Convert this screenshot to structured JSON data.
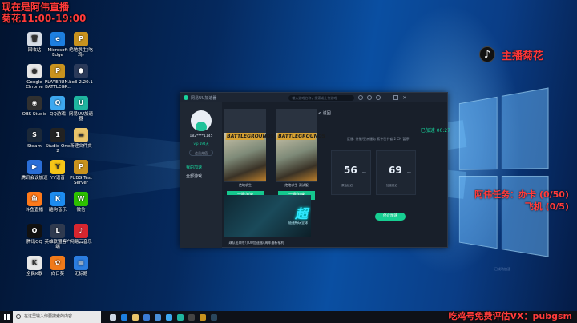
{
  "overlay": {
    "line1": "现在是阿伟直播",
    "line2": "菊花11:00-19:00",
    "tiktok_icon": "tiktok-icon",
    "streamer": "主播菊花",
    "task1": "阿伟任务：办卡 (0/50)",
    "task2": "飞机 (0/5)",
    "promo": "吃鸡号免费评估VX：pubgsm"
  },
  "desktop_icons": [
    {
      "label": "回收站",
      "color": "#d7dde6",
      "glyph": "🗑"
    },
    {
      "label": "Microsoft Edge",
      "color": "#1d7fe0",
      "glyph": "e"
    },
    {
      "label": "绝地求生(吃鸡)",
      "color": "#c8921e",
      "glyph": "P"
    },
    {
      "label": "Google Chrome",
      "color": "#e6e6e6",
      "glyph": "●"
    },
    {
      "label": "PLAYERUN.. BATTLEGR..",
      "color": "#c8921e",
      "glyph": "P"
    },
    {
      "label": "bo3-2.20.1",
      "color": "#2a3a5a",
      "glyph": "⬢"
    },
    {
      "label": "OBS Studio",
      "color": "#303030",
      "glyph": "◉"
    },
    {
      "label": "QQ游戏",
      "color": "#3da8f0",
      "glyph": "Q"
    },
    {
      "label": "网易UU加速器",
      "color": "#1fb5a0",
      "glyph": "U"
    },
    {
      "label": "Steam",
      "color": "#1b2838",
      "glyph": "S"
    },
    {
      "label": "Studio One 2",
      "color": "#222",
      "glyph": "1"
    },
    {
      "label": "新建文件夹",
      "color": "#e9c46a",
      "glyph": "▬"
    },
    {
      "label": "腾讯会议加速",
      "color": "#2a6ed8",
      "glyph": "▶"
    },
    {
      "label": "YY语音",
      "color": "#f5c518",
      "glyph": "Y"
    },
    {
      "label": "PUBG Test Server",
      "color": "#c8921e",
      "glyph": "P"
    },
    {
      "label": "斗鱼直播",
      "color": "#ff7a1a",
      "glyph": "鱼"
    },
    {
      "label": "酷狗音乐",
      "color": "#1d8cf0",
      "glyph": "K"
    },
    {
      "label": "微信",
      "color": "#2dc100",
      "glyph": "W"
    },
    {
      "label": "腾讯QQ",
      "color": "#111",
      "glyph": "Q"
    },
    {
      "label": "英雄联盟客户端",
      "color": "#2f3a4f",
      "glyph": "L"
    },
    {
      "label": "网易云音乐",
      "color": "#d7262f",
      "glyph": "♪"
    },
    {
      "label": "全民K歌",
      "color": "#e8e8e8",
      "glyph": "K"
    },
    {
      "label": "向日葵",
      "color": "#f07a1a",
      "glyph": "✿"
    },
    {
      "label": "无标题",
      "color": "#2b7de0",
      "glyph": "▤"
    }
  ],
  "app": {
    "title": "网易UU加速器",
    "search_placeholder": "输入游戏名称，搜索或上传游戏",
    "title_icons": [
      "message-icon",
      "gift-icon",
      "settings-icon",
      "minimize-icon",
      "maximize-icon",
      "close-icon"
    ],
    "user_id": "182****1145",
    "vip_text": "vip 194天",
    "vip_button": "会员充值",
    "nav": [
      "我的加速",
      "全部游戏"
    ],
    "games": [
      {
        "title": "绝地求生",
        "button": "一键加速"
      },
      {
        "title": "绝地求生-测试服",
        "button": "一键加速"
      }
    ],
    "banner_big": "超",
    "banner_sub": "极速畅玩全球",
    "notice": "[球队出来啦!] UU加速器4周年最新福利",
    "back": "< 返回",
    "status": "已加速 00:27",
    "info_line": "区服: 外服/亚洲服务   累计已节省 2 CN  暂停",
    "stats": [
      {
        "value": "56",
        "unit": "ms",
        "label": "原始延迟"
      },
      {
        "value": "69",
        "unit": "ms",
        "label": "加速延迟"
      }
    ],
    "stop_button": "停止加速",
    "watermark": "已成功加速"
  },
  "taskbar": {
    "search_placeholder": "在这里输入你要搜索的内容",
    "apps": [
      {
        "name": "task-view-icon",
        "color": "#cfd8e4"
      },
      {
        "name": "edge-icon",
        "color": "#1d7fe0"
      },
      {
        "name": "explorer-icon",
        "color": "#e9c46a"
      },
      {
        "name": "store-icon",
        "color": "#3a7bd5"
      },
      {
        "name": "mail-icon",
        "color": "#4a90d9"
      },
      {
        "name": "qq-icon",
        "color": "#3da8f0"
      },
      {
        "name": "uu-icon",
        "color": "#1fb5a0"
      },
      {
        "name": "obs-icon",
        "color": "#444"
      },
      {
        "name": "pubg-icon",
        "color": "#c8921e"
      },
      {
        "name": "steam-icon",
        "color": "#2a475e"
      }
    ]
  }
}
